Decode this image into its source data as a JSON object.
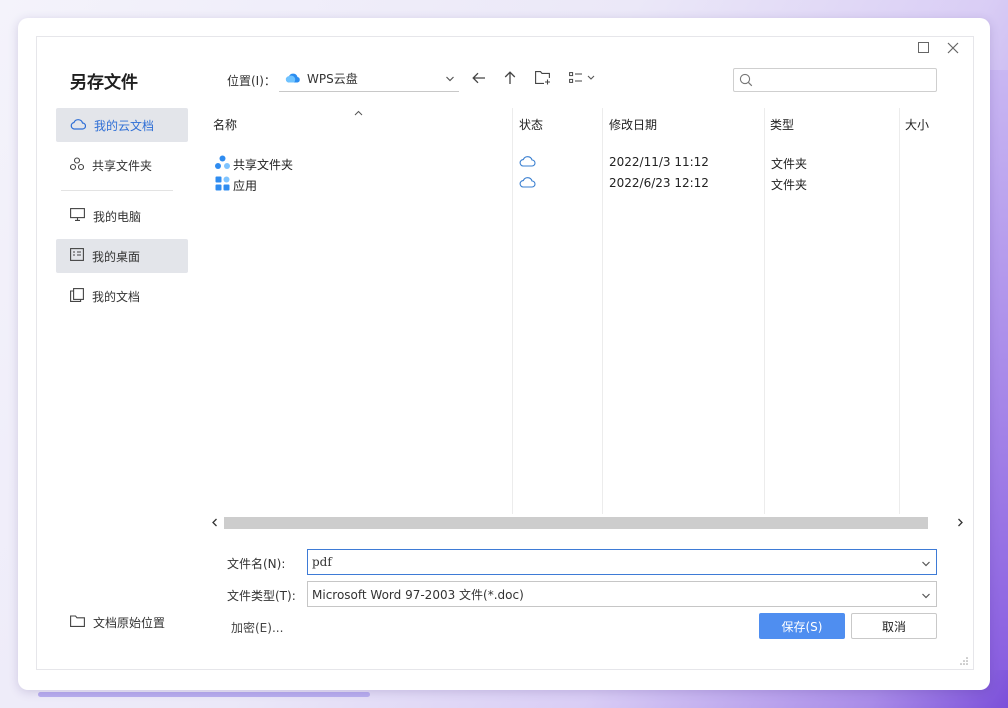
{
  "dialog": {
    "title": "另存文件",
    "maximize_icon": "maximize-icon",
    "close_icon": "close-icon"
  },
  "sidebar": {
    "items": [
      {
        "label": "我的云文档",
        "icon": "cloud-icon",
        "active": true
      },
      {
        "label": "共享文件夹",
        "icon": "share-nodes-icon",
        "active": false
      },
      {
        "label": "我的电脑",
        "icon": "monitor-icon",
        "active": false
      },
      {
        "label": "我的桌面",
        "icon": "desktop-icon",
        "active": true
      },
      {
        "label": "我的文档",
        "icon": "documents-icon",
        "active": false
      }
    ],
    "bottom_label": "文档原始位置"
  },
  "location": {
    "label": "位置(I)：",
    "value": "WPS云盘"
  },
  "toolbar": {
    "back_icon": "arrow-left-icon",
    "up_icon": "arrow-up-icon",
    "new_folder_icon": "new-folder-icon",
    "view_icon": "view-list-icon"
  },
  "search": {
    "placeholder": ""
  },
  "table": {
    "columns": [
      "名称",
      "状态",
      "修改日期",
      "类型",
      "大小"
    ],
    "rows": [
      {
        "name": "共享文件夹",
        "icon": "shared-folder-icon",
        "status": "cloud-icon",
        "modified": "2022/11/3 11:12",
        "type": "文件夹",
        "size": ""
      },
      {
        "name": "应用",
        "icon": "apps-icon",
        "status": "cloud-icon",
        "modified": "2022/6/23 12:12",
        "type": "文件夹",
        "size": ""
      }
    ]
  },
  "form": {
    "filename_label": "文件名(N):",
    "filename_value": "pdf",
    "filetype_label": "文件类型(T):",
    "filetype_value": "Microsoft Word 97-2003 文件(*.doc)",
    "encrypt_label": "加密(E)...",
    "save_label": "保存(S)",
    "cancel_label": "取消"
  },
  "colors": {
    "accent": "#4f8ef0",
    "sidebar_selected_text": "#2f6fd6",
    "sidebar_active_bg": "#e3e5ea"
  }
}
